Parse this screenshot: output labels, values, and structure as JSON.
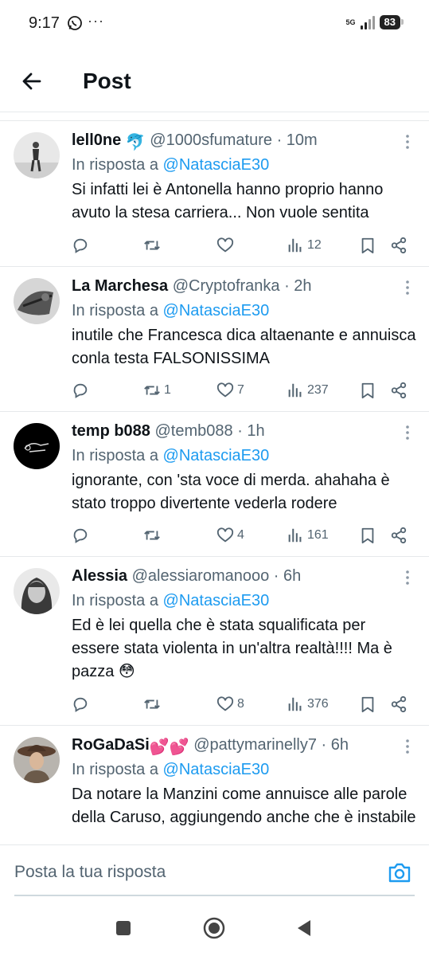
{
  "status_bar": {
    "time": "9:17",
    "dots": "···",
    "network": "5G",
    "battery": "83"
  },
  "header": {
    "title": "Post"
  },
  "tweets": [
    {
      "name": "lell0ne",
      "name_emoji": "🐬",
      "handle": "@1000sfumature",
      "time": " · 10m",
      "reply_prefix": "In risposta a ",
      "reply_to": "@NatasciaE30",
      "text": "Si infatti lei è Antonella hanno proprio hanno avuto la stesa carriera... Non vuole sentita",
      "retweets": "",
      "likes": "",
      "views": "12"
    },
    {
      "name": "La Marchesa",
      "name_emoji": "",
      "handle": "@Cryptofranka",
      "time": " · 2h",
      "reply_prefix": "In risposta a ",
      "reply_to": "@NatasciaE30",
      "text": "inutile che Francesca dica altaenante e annuisca conla testa FALSONISSIMA",
      "retweets": "1",
      "likes": "7",
      "views": "237"
    },
    {
      "name": "temp b088",
      "name_emoji": "",
      "handle": "@temb088",
      "time": " · 1h",
      "reply_prefix": "In risposta a ",
      "reply_to": "@NatasciaE30",
      "text": "ignorante, con 'sta voce di merda. ahahaha è stato troppo divertente vederla rodere",
      "retweets": "",
      "likes": "4",
      "views": "161"
    },
    {
      "name": "Alessia",
      "name_emoji": "",
      "handle": "@alessiaromanooo",
      "time": " · 6h",
      "reply_prefix": "In risposta a ",
      "reply_to": "@NatasciaE30",
      "text": "Ed è lei quella che è stata squalificata per essere stata violenta in un'altra realtà!!!! Ma è pazza 😳",
      "retweets": "",
      "likes": "8",
      "views": "376"
    },
    {
      "name": "RoGaDaSi",
      "name_emoji": "💕💕",
      "handle": "@pattymarinelly7",
      "time": " · 6h",
      "reply_prefix": "In risposta a ",
      "reply_to": "@NatasciaE30",
      "text": "Da notare la Manzini come annuisce alle parole della Caruso, aggiungendo anche che è instabile",
      "retweets": "",
      "likes": "",
      "views": ""
    }
  ],
  "composer": {
    "placeholder": "Posta la tua risposta"
  },
  "colors": {
    "accent": "#1d9bf0",
    "secondary_text": "#536471",
    "text": "#0f1419",
    "divider": "#e6e9eb"
  },
  "icons": {
    "back": "arrow-left-icon",
    "reply": "speech-bubble-icon",
    "retweet": "retweet-icon",
    "like": "heart-icon",
    "views": "bar-chart-icon",
    "bookmark": "bookmark-icon",
    "share": "share-icon",
    "more": "more-vertical-icon",
    "camera": "camera-icon",
    "nav_recents": "square-icon",
    "nav_home": "circle-icon",
    "nav_back": "triangle-back-icon"
  }
}
